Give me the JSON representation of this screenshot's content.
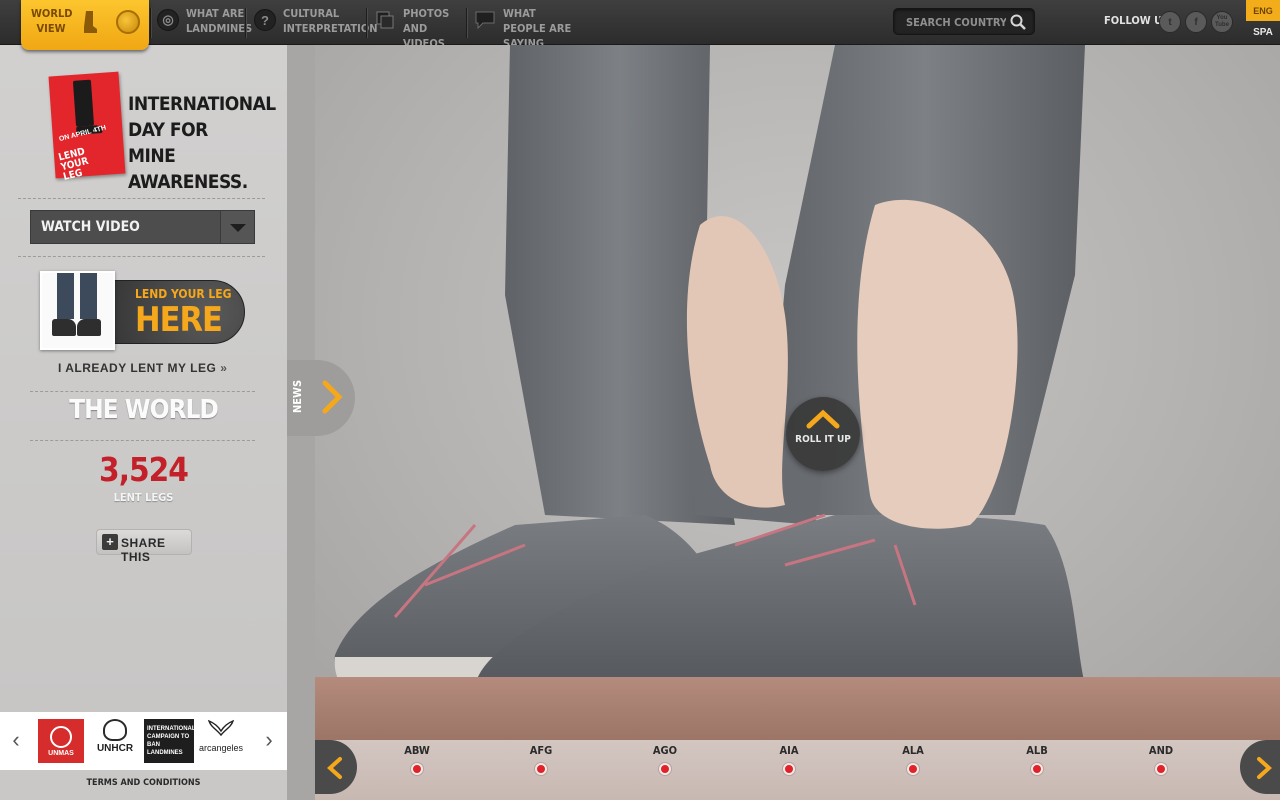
{
  "nav": {
    "world_view": "World View",
    "items": [
      {
        "label": "What are Landmines",
        "icon": "target-icon"
      },
      {
        "label": "Cultural Interpretation",
        "icon": "question-icon"
      },
      {
        "label": "Photos and Videos",
        "icon": "photos-icon"
      },
      {
        "label": "What people are saying",
        "icon": "speech-bubble-icon"
      }
    ],
    "search_placeholder": "Search Country",
    "follow_us": "Follow us",
    "social": [
      {
        "name": "twitter",
        "glyph": "t"
      },
      {
        "name": "facebook",
        "glyph": "f"
      },
      {
        "name": "youtube",
        "glyph": "You Tube"
      }
    ],
    "languages": [
      "ENG",
      "SPA"
    ],
    "accent_color": "#f5a81c"
  },
  "sidebar": {
    "logo_small": "On April 4th",
    "logo_big": "Lend your leg",
    "day_title": "International day for mine awareness.",
    "watch_video": "Watch Video",
    "lend_small": "Lend your leg",
    "lend_big": "Here",
    "already_lent": "I already lent my leg",
    "region": "The World",
    "count": "3,524",
    "count_label": "Lent Legs",
    "share": "Share this",
    "count_color": "#c4202a"
  },
  "sponsors": {
    "unmas": "UNMAS",
    "unhcr": "UNHCR",
    "icbl": "International Campaign to Ban Landmines",
    "arcangeles": "arcangeles"
  },
  "terms": "Terms and Conditions",
  "news": "News",
  "roll_it_up": "Roll it up",
  "countries": [
    "ABW",
    "AFG",
    "AGO",
    "AIA",
    "ALA",
    "ALB",
    "AND"
  ]
}
